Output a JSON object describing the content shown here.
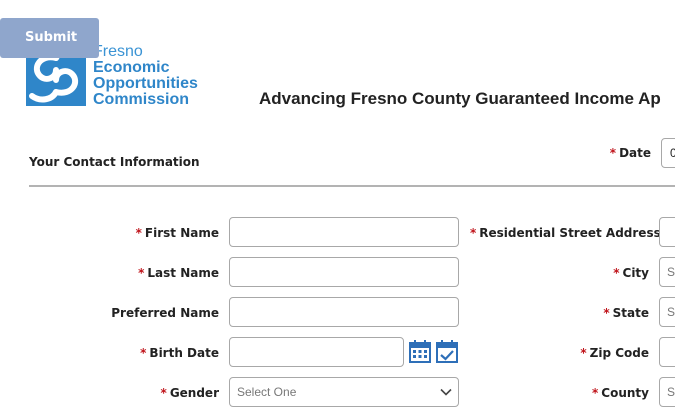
{
  "header": {
    "submit_label": "Submit",
    "logo": {
      "line1": "Fresno",
      "line2": "Economic",
      "line3": "Opportunities",
      "line4": "Commission"
    },
    "title": "Advancing Fresno County Guaranteed Income Ap"
  },
  "section": {
    "title": "Your Contact Information"
  },
  "date_field": {
    "label": "Date",
    "value": "0"
  },
  "left_fields": [
    {
      "label": "First Name",
      "required": "*",
      "value": ""
    },
    {
      "label": "Last Name",
      "required": "*",
      "value": ""
    },
    {
      "label": "Preferred Name",
      "required": "",
      "value": ""
    },
    {
      "label": "Birth Date",
      "required": "*",
      "value": ""
    },
    {
      "label": "Gender",
      "required": "*",
      "value": "Select One"
    }
  ],
  "right_fields": [
    {
      "label": "Residential Street Address",
      "required": "*",
      "value": ""
    },
    {
      "label": "City",
      "required": "*",
      "value": "Se"
    },
    {
      "label": "State",
      "required": "*",
      "value": "Se"
    },
    {
      "label": "Zip Code",
      "required": "*",
      "value": ""
    },
    {
      "label": "County",
      "required": "*",
      "value": "Se"
    }
  ],
  "colors": {
    "accent": "#2f86c9",
    "required": "#c0141b",
    "submit_bg": "#8fa6cc",
    "calendar": "#2e6fb8"
  },
  "icons": {
    "calendar": "calendar-icon",
    "calendar_check": "calendar-check-icon",
    "dropdown": "chevron-down-icon"
  }
}
